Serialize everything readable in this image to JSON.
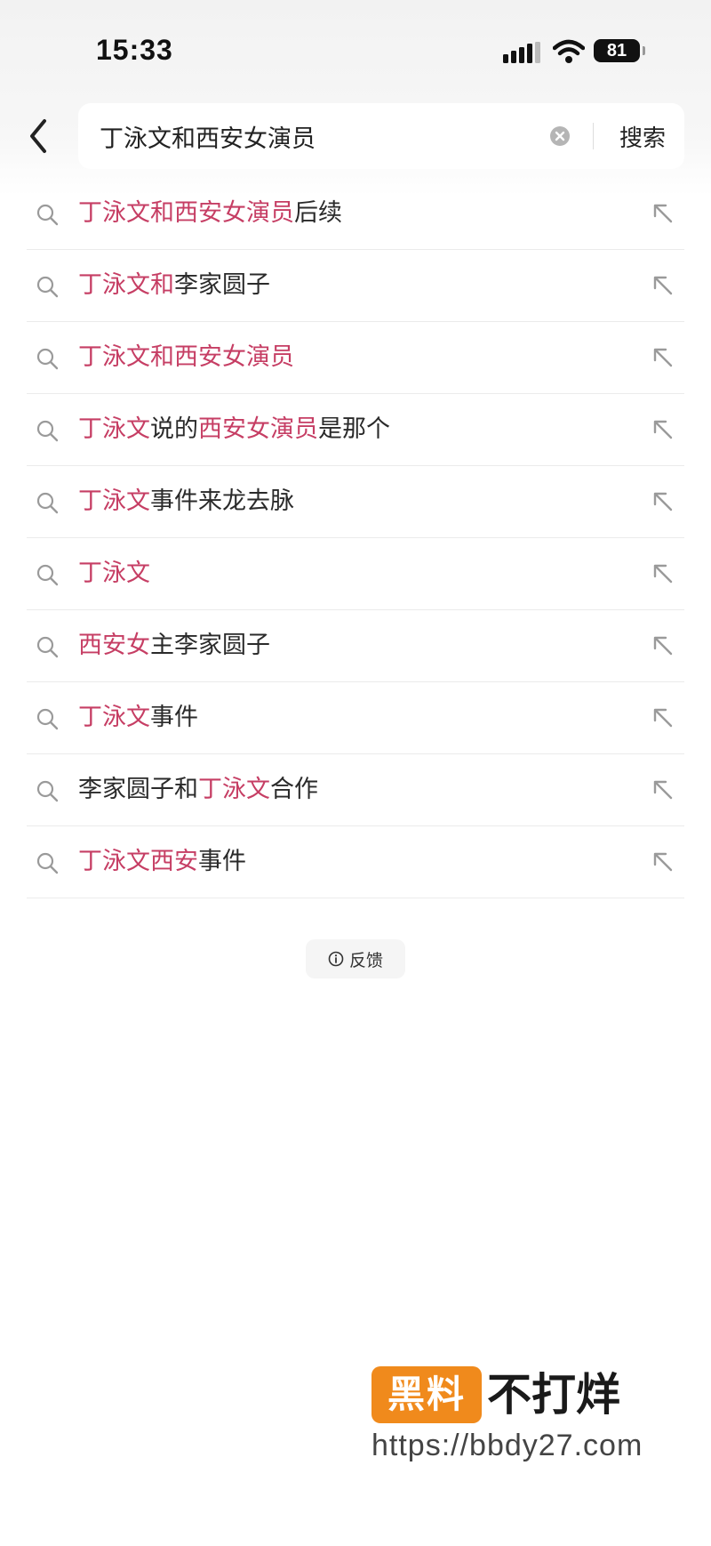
{
  "status_bar": {
    "time": "15:33",
    "battery": "81",
    "icons": [
      "signal-icon",
      "wifi-icon",
      "battery-icon"
    ]
  },
  "search_bar": {
    "back_icon": "chevron-left-icon",
    "query": "丁泳文和西安女演员",
    "clear_icon": "clear-circle-icon",
    "search_label": "搜索"
  },
  "suggestions": [
    {
      "highlight": "丁泳文和西安女演员",
      "rest": "后续"
    },
    {
      "highlight": "丁泳文和",
      "rest": "李家圆子"
    },
    {
      "highlight": "丁泳文和西安女演员",
      "rest": ""
    },
    {
      "highlight": "丁泳文",
      "rest": "说的",
      "highlight2": "西安女演员",
      "rest2": "是那个"
    },
    {
      "highlight": "丁泳文",
      "rest": "事件来龙去脉"
    },
    {
      "highlight": "丁泳文",
      "rest": ""
    },
    {
      "highlight": "西安女",
      "rest": "主李家圆子"
    },
    {
      "highlight": "丁泳文",
      "rest": "事件"
    },
    {
      "prefix": "李家圆子和",
      "highlight": "丁泳文",
      "rest": "合作"
    },
    {
      "highlight": "丁泳文西安",
      "rest": "事件"
    }
  ],
  "feedback": {
    "label": "反馈",
    "icon": "info-circle-icon"
  },
  "watermark": {
    "logo_box": "黑料",
    "logo_text": "不打烊",
    "url": "https://bbdy27.com"
  },
  "colors": {
    "highlight": "#c63e64",
    "text": "#2a2a2a",
    "watermark_orange": "#f08a1c"
  }
}
